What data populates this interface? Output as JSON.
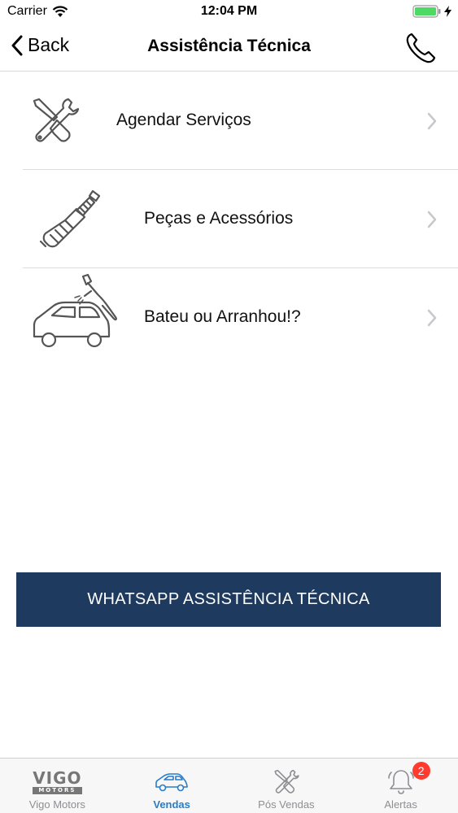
{
  "status_bar": {
    "carrier": "Carrier",
    "time": "12:04 PM"
  },
  "nav": {
    "back_label": "Back",
    "title": "Assistência Técnica"
  },
  "menu": {
    "items": [
      {
        "label": "Agendar Serviços",
        "icon": "wrench-screwdriver-icon"
      },
      {
        "label": "Peças e Acessórios",
        "icon": "spark-plug-icon"
      },
      {
        "label": "Bateu ou Arranhou!?",
        "icon": "car-paint-icon"
      }
    ]
  },
  "whatsapp_button": {
    "label": "WHATSAPP ASSISTÊNCIA TÉCNICA"
  },
  "tab_bar": {
    "logo_text": "VIGO",
    "logo_subtext": "MOTORS",
    "tabs": [
      {
        "label": "Vigo Motors",
        "active": false
      },
      {
        "label": "Vendas",
        "active": true
      },
      {
        "label": "Pós Vendas",
        "active": false
      },
      {
        "label": "Alertas",
        "active": false,
        "badge": "2"
      }
    ]
  },
  "colors": {
    "primary_button": "#1e3a5f",
    "active_tab": "#2a7cc7",
    "badge": "#ff3b30",
    "battery": "#4cd964"
  }
}
